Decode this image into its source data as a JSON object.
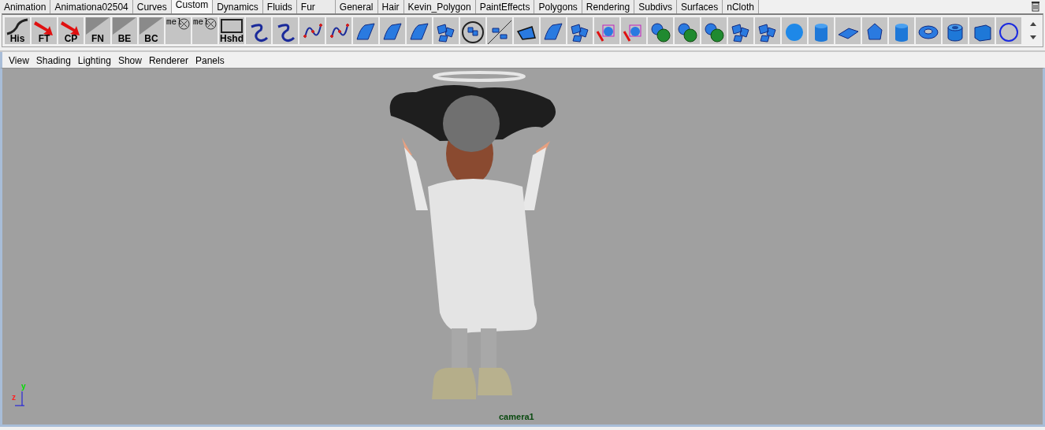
{
  "shelf_tabs": [
    {
      "label": "Animation",
      "selected": false
    },
    {
      "label": "Animationa02504",
      "selected": false
    },
    {
      "label": "Curves",
      "selected": false
    },
    {
      "label": "Custom",
      "selected": true
    },
    {
      "label": "Dynamics",
      "selected": false
    },
    {
      "label": "Fluids",
      "selected": false
    },
    {
      "label": "Fur",
      "selected": false
    },
    {
      "label": "General",
      "selected": false
    },
    {
      "label": "Hair",
      "selected": false
    },
    {
      "label": "Kevin_Polygon",
      "selected": false
    },
    {
      "label": "PaintEffects",
      "selected": false
    },
    {
      "label": "Polygons",
      "selected": false
    },
    {
      "label": "Rendering",
      "selected": false
    },
    {
      "label": "Subdivs",
      "selected": false
    },
    {
      "label": "Surfaces",
      "selected": false
    },
    {
      "label": "nCloth",
      "selected": false
    }
  ],
  "shelf_buttons": [
    {
      "kind": "swoosh",
      "label": "His"
    },
    {
      "kind": "arrow",
      "label": "FT"
    },
    {
      "kind": "arrow",
      "label": "CP"
    },
    {
      "kind": "diagonal",
      "label": "FN"
    },
    {
      "kind": "diagonal",
      "label": "BE"
    },
    {
      "kind": "diagonal",
      "label": "BC"
    },
    {
      "kind": "mel",
      "label": "mel"
    },
    {
      "kind": "mel",
      "label": "mel"
    },
    {
      "kind": "frame",
      "label": "Hshd"
    },
    {
      "kind": "curve"
    },
    {
      "kind": "curve"
    },
    {
      "kind": "points"
    },
    {
      "kind": "points"
    },
    {
      "kind": "surface"
    },
    {
      "kind": "surface"
    },
    {
      "kind": "surface"
    },
    {
      "kind": "tiles"
    },
    {
      "kind": "ringtiles"
    },
    {
      "kind": "mirror"
    },
    {
      "kind": "quad"
    },
    {
      "kind": "surface"
    },
    {
      "kind": "tiles"
    },
    {
      "kind": "cage"
    },
    {
      "kind": "cage"
    },
    {
      "kind": "ball"
    },
    {
      "kind": "ball"
    },
    {
      "kind": "ball"
    },
    {
      "kind": "tiles"
    },
    {
      "kind": "tiles"
    },
    {
      "kind": "sphere"
    },
    {
      "kind": "cylinder"
    },
    {
      "kind": "plane"
    },
    {
      "kind": "dome"
    },
    {
      "kind": "cylinder"
    },
    {
      "kind": "torus"
    },
    {
      "kind": "pipe"
    },
    {
      "kind": "cube"
    },
    {
      "kind": "circle"
    }
  ],
  "panel_menu": [
    "View",
    "Shading",
    "Lighting",
    "Show",
    "Renderer",
    "Panels"
  ],
  "viewport": {
    "axis_labels": [
      "y",
      "z"
    ],
    "camera": "camera1"
  }
}
